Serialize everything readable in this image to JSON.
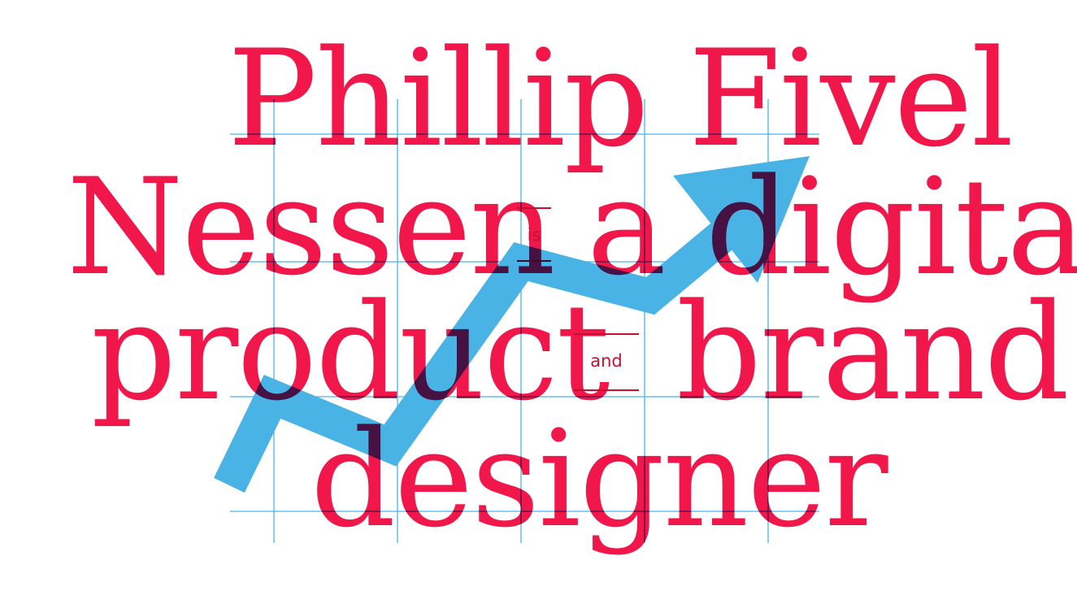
{
  "headline": {
    "line1": "Phillip Fivel",
    "line2_start": "Nessen",
    "line2_end": "a digital",
    "line3_start": "product",
    "line3_end": "brand",
    "line4": "designer"
  },
  "connectors": {
    "is": "is",
    "and": "and"
  },
  "colors": {
    "text": "#f2174a",
    "connector": "#c8102e",
    "arrow": "#4ab3e6",
    "grid": "#4ab3e6",
    "background": "#ffffff"
  },
  "icons": {
    "arrow": "trend-up-arrow-icon"
  }
}
